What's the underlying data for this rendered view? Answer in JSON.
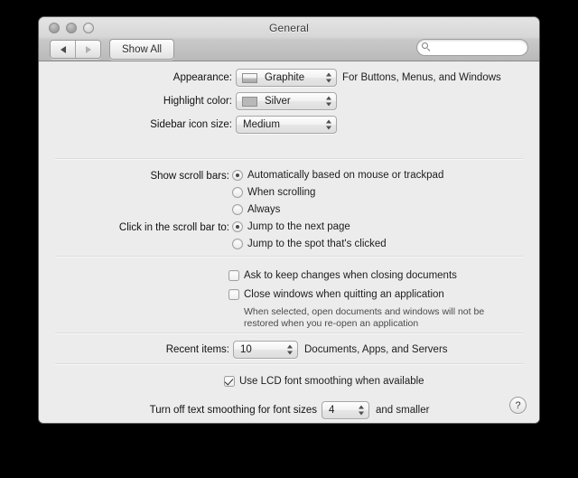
{
  "window": {
    "title": "General",
    "traffic_lights": [
      "close",
      "minimize",
      "zoom"
    ]
  },
  "toolbar": {
    "back_label": "Back",
    "forward_label": "Forward",
    "show_all_label": "Show All",
    "search_placeholder": "",
    "search_value": "",
    "search_icon": "search-icon"
  },
  "appearance": {
    "label": "Appearance:",
    "value": "Graphite",
    "swatch": "graphite",
    "hint": "For Buttons, Menus, and Windows"
  },
  "highlight": {
    "label": "Highlight color:",
    "value": "Silver",
    "swatch": "silver"
  },
  "sidebar_icon_size": {
    "label": "Sidebar icon size:",
    "value": "Medium"
  },
  "scroll_bars": {
    "label": "Show scroll bars:",
    "options": [
      {
        "label": "Automatically based on mouse or trackpad",
        "selected": true
      },
      {
        "label": "When scrolling",
        "selected": false
      },
      {
        "label": "Always",
        "selected": false
      }
    ]
  },
  "click_scroll_bar": {
    "label": "Click in the scroll bar to:",
    "options": [
      {
        "label": "Jump to the next page",
        "selected": true
      },
      {
        "label": "Jump to the spot that's clicked",
        "selected": false
      }
    ]
  },
  "documents": {
    "ask_keep_changes": {
      "label": "Ask to keep changes when closing documents",
      "checked": false
    },
    "close_windows": {
      "label": "Close windows when quitting an application",
      "checked": false
    },
    "close_windows_help": "When selected, open documents and windows will not be restored when you re-open an application"
  },
  "recent_items": {
    "label": "Recent items:",
    "value": "10",
    "hint": "Documents, Apps, and Servers"
  },
  "font_smoothing": {
    "lcd": {
      "label": "Use LCD font smoothing when available",
      "checked": true
    },
    "turn_off_prefix": "Turn off text smoothing for font sizes",
    "size_value": "4",
    "turn_off_suffix": "and smaller"
  },
  "help": {
    "label": "?"
  },
  "colors": {
    "window_bg": "#ececec",
    "titlebar_top": "#e4e4e4",
    "titlebar_bottom": "#b9b9b9",
    "text": "#1d1d1d",
    "backdrop": "#000000"
  }
}
